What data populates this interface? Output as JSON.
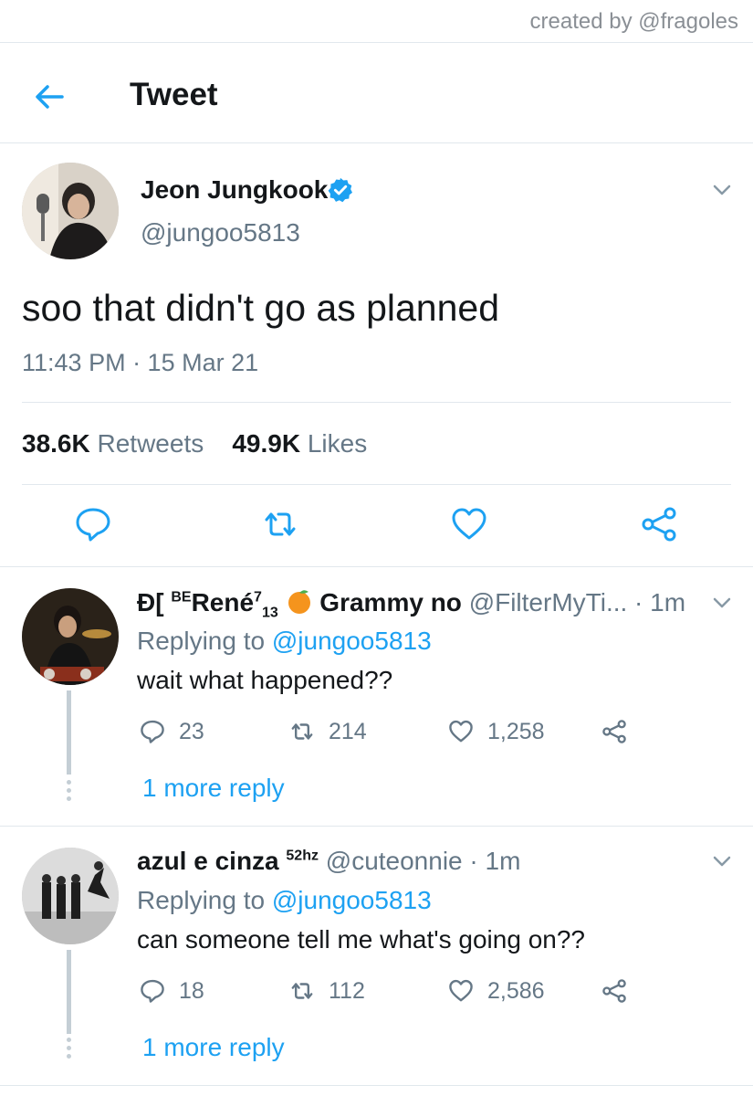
{
  "credit": "created by @fragoles",
  "header": {
    "title": "Tweet"
  },
  "tweet": {
    "author_name": "Jeon Jungkook",
    "author_handle": "@jungoo5813",
    "text": "soo that didn't go as planned",
    "timestamp": "11:43 PM · 15 Mar 21",
    "retweets_count": "38.6K",
    "retweets_label": "Retweets",
    "likes_count": "49.9K",
    "likes_label": "Likes"
  },
  "replies": [
    {
      "name_prefix": "BE",
      "name_main": "René",
      "name_sup": "7",
      "name_sub": "13",
      "name_suffix": "Grammy no",
      "handle_time": "@FilterMyTi... · 1m",
      "replying_prefix": "Replying to",
      "replying_handle": "@jungoo5813",
      "text": "wait what happened??",
      "replies": "23",
      "retweets": "214",
      "likes": "1,258",
      "more": "1 more reply"
    },
    {
      "name_main": "azul e cinza",
      "name_sup": "52hz",
      "handle_time": "@cuteonnie · 1m",
      "replying_prefix": "Replying to",
      "replying_handle": "@jungoo5813",
      "text": "can someone tell me what's going on??",
      "replies": "18",
      "retweets": "112",
      "likes": "2,586",
      "more": "1 more reply"
    }
  ],
  "colors": {
    "accent": "#1da1f2",
    "secondary_text": "#657786",
    "divider": "#e1e8ed"
  }
}
